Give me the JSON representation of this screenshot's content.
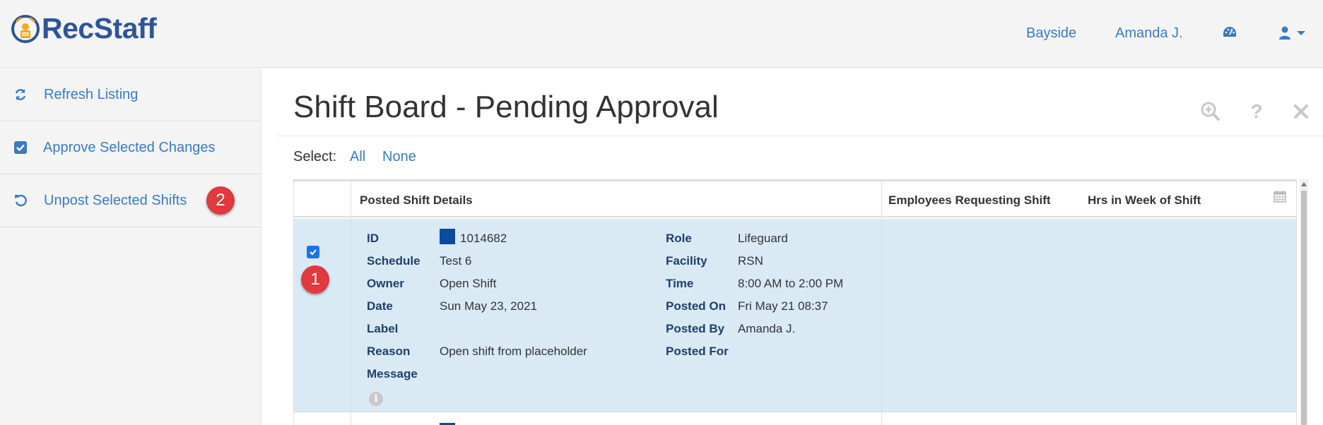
{
  "header": {
    "logo_text": "RecStaff",
    "nav": {
      "location": "Bayside",
      "user": "Amanda J."
    }
  },
  "sidebar": {
    "items": [
      {
        "label": "Refresh Listing",
        "icon": "refresh-icon"
      },
      {
        "label": "Approve Selected Changes",
        "icon": "check-square-icon"
      },
      {
        "label": "Unpost Selected Shifts",
        "icon": "undo-icon",
        "badge": "2"
      }
    ]
  },
  "page": {
    "title": "Shift Board - Pending Approval",
    "select_label": "Select:",
    "select_all": "All",
    "select_none": "None",
    "tools": [
      "zoom-in-icon",
      "help-icon",
      "close-icon"
    ]
  },
  "table": {
    "headers": {
      "details": "Posted Shift Details",
      "employees": "Employees Requesting Shift",
      "hours": "Hrs in Week of Shift"
    },
    "row": {
      "checked": true,
      "badge": "1",
      "swatch_color": "#0a4aa0",
      "left": [
        {
          "label": "ID",
          "value": "1014682"
        },
        {
          "label": "Schedule",
          "value": "Test 6"
        },
        {
          "label": "Owner",
          "value": "Open Shift"
        },
        {
          "label": "Date",
          "value": "Sun May 23, 2021"
        },
        {
          "label": "Label",
          "value": ""
        },
        {
          "label": "Reason",
          "value": "Open shift from placeholder"
        },
        {
          "label": "Message",
          "value": ""
        }
      ],
      "right": [
        {
          "label": "Role",
          "value": "Lifeguard"
        },
        {
          "label": "Facility",
          "value": "RSN"
        },
        {
          "label": "Time",
          "value": "8:00 AM to 2:00 PM"
        },
        {
          "label": "Posted On",
          "value": "Fri May 21 08:37"
        },
        {
          "label": "Posted By",
          "value": "Amanda J."
        },
        {
          "label": "Posted For",
          "value": ""
        }
      ]
    }
  },
  "colors": {
    "link": "#3a7bbf",
    "row_selected": "#d9eaf5",
    "badge": "#e0393e",
    "label_text": "#1f3f6b"
  }
}
